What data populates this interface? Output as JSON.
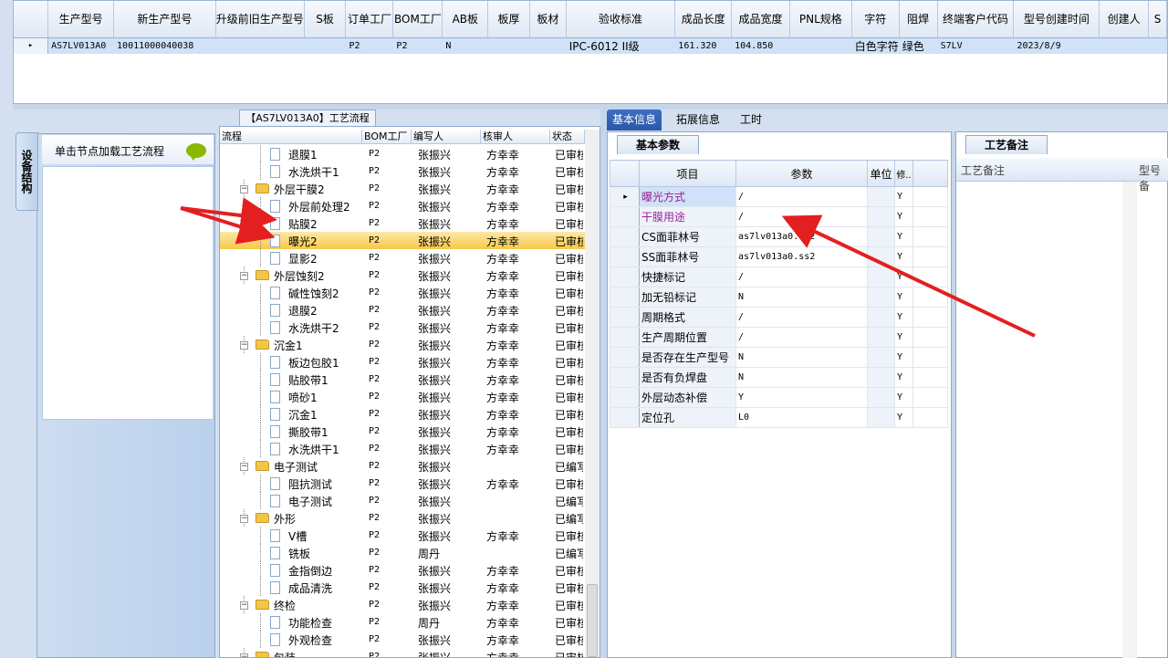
{
  "top_grid": {
    "columns": [
      "生产型号",
      "新生产型号",
      "升级前旧生产型号",
      "S板",
      "订单工厂",
      "BOM工厂",
      "AB板",
      "板厚",
      "板材",
      "验收标准",
      "成品长度",
      "成品宽度",
      "PNL规格",
      "字符",
      "阻焊",
      "终端客户代码",
      "型号创建时间",
      "创建人",
      "S"
    ],
    "row": [
      "AS7LV013A0",
      "10011000040038",
      "",
      "",
      "P2",
      "P2",
      "N",
      "",
      "",
      "IPC-6012 II级",
      "161.320",
      "104.850",
      "",
      "白色字符",
      "绿色",
      "S7LV",
      "2023/8/9",
      "",
      ""
    ],
    "row_indicator": "▸"
  },
  "side": {
    "vertical_tab": "设备结构",
    "header": "单击节点加载工艺流程"
  },
  "tree": {
    "title": "【AS7LV013A0】工艺流程",
    "columns": [
      "流程",
      "BOM工厂",
      "编写人",
      "核审人",
      "状态"
    ],
    "rows": [
      {
        "label": "退膜1",
        "level": 2,
        "type": "file",
        "bom": "P2",
        "writer": "张振兴",
        "reviewer": "方幸幸",
        "status": "已审核"
      },
      {
        "label": "水洗烘干1",
        "level": 2,
        "type": "file",
        "bom": "P2",
        "writer": "张振兴",
        "reviewer": "方幸幸",
        "status": "已审核"
      },
      {
        "label": "外层干膜2",
        "level": 1,
        "type": "folder",
        "bom": "P2",
        "writer": "张振兴",
        "reviewer": "方幸幸",
        "status": "已审核"
      },
      {
        "label": "外层前处理2",
        "level": 2,
        "type": "file",
        "bom": "P2",
        "writer": "张振兴",
        "reviewer": "方幸幸",
        "status": "已审核"
      },
      {
        "label": "贴膜2",
        "level": 2,
        "type": "file",
        "bom": "P2",
        "writer": "张振兴",
        "reviewer": "方幸幸",
        "status": "已审核"
      },
      {
        "label": "曝光2",
        "level": 2,
        "type": "file",
        "bom": "P2",
        "writer": "张振兴",
        "reviewer": "方幸幸",
        "status": "已审核",
        "selected": true
      },
      {
        "label": "显影2",
        "level": 2,
        "type": "file",
        "bom": "P2",
        "writer": "张振兴",
        "reviewer": "方幸幸",
        "status": "已审核"
      },
      {
        "label": "外层蚀刻2",
        "level": 1,
        "type": "folder",
        "bom": "P2",
        "writer": "张振兴",
        "reviewer": "方幸幸",
        "status": "已审核"
      },
      {
        "label": "碱性蚀刻2",
        "level": 2,
        "type": "file",
        "bom": "P2",
        "writer": "张振兴",
        "reviewer": "方幸幸",
        "status": "已审核"
      },
      {
        "label": "退膜2",
        "level": 2,
        "type": "file",
        "bom": "P2",
        "writer": "张振兴",
        "reviewer": "方幸幸",
        "status": "已审核"
      },
      {
        "label": "水洗烘干2",
        "level": 2,
        "type": "file",
        "bom": "P2",
        "writer": "张振兴",
        "reviewer": "方幸幸",
        "status": "已审核"
      },
      {
        "label": "沉金1",
        "level": 1,
        "type": "folder",
        "bom": "P2",
        "writer": "张振兴",
        "reviewer": "方幸幸",
        "status": "已审核"
      },
      {
        "label": "板边包胶1",
        "level": 2,
        "type": "file",
        "bom": "P2",
        "writer": "张振兴",
        "reviewer": "方幸幸",
        "status": "已审核"
      },
      {
        "label": "贴胶带1",
        "level": 2,
        "type": "file",
        "bom": "P2",
        "writer": "张振兴",
        "reviewer": "方幸幸",
        "status": "已审核"
      },
      {
        "label": "喷砂1",
        "level": 2,
        "type": "file",
        "bom": "P2",
        "writer": "张振兴",
        "reviewer": "方幸幸",
        "status": "已审核"
      },
      {
        "label": "沉金1",
        "level": 2,
        "type": "file",
        "bom": "P2",
        "writer": "张振兴",
        "reviewer": "方幸幸",
        "status": "已审核"
      },
      {
        "label": "撕胶带1",
        "level": 2,
        "type": "file",
        "bom": "P2",
        "writer": "张振兴",
        "reviewer": "方幸幸",
        "status": "已审核"
      },
      {
        "label": "水洗烘干1",
        "level": 2,
        "type": "file",
        "bom": "P2",
        "writer": "张振兴",
        "reviewer": "方幸幸",
        "status": "已审核"
      },
      {
        "label": "电子测试",
        "level": 1,
        "type": "folder",
        "bom": "P2",
        "writer": "张振兴",
        "reviewer": "",
        "status": "已编写"
      },
      {
        "label": "阻抗测试",
        "level": 2,
        "type": "file",
        "bom": "P2",
        "writer": "张振兴",
        "reviewer": "方幸幸",
        "status": "已审核"
      },
      {
        "label": "电子测试",
        "level": 2,
        "type": "file",
        "bom": "P2",
        "writer": "张振兴",
        "reviewer": "",
        "status": "已编写"
      },
      {
        "label": "外形",
        "level": 1,
        "type": "folder",
        "bom": "P2",
        "writer": "张振兴",
        "reviewer": "",
        "status": "已编写"
      },
      {
        "label": "V槽",
        "level": 2,
        "type": "file",
        "bom": "P2",
        "writer": "张振兴",
        "reviewer": "方幸幸",
        "status": "已审核"
      },
      {
        "label": "铣板",
        "level": 2,
        "type": "file",
        "bom": "P2",
        "writer": "周丹",
        "reviewer": "",
        "status": "已编写"
      },
      {
        "label": "金指倒边",
        "level": 2,
        "type": "file",
        "bom": "P2",
        "writer": "张振兴",
        "reviewer": "方幸幸",
        "status": "已审核"
      },
      {
        "label": "成品清洗",
        "level": 2,
        "type": "file",
        "bom": "P2",
        "writer": "张振兴",
        "reviewer": "方幸幸",
        "status": "已审核"
      },
      {
        "label": "终检",
        "level": 1,
        "type": "folder",
        "bom": "P2",
        "writer": "张振兴",
        "reviewer": "方幸幸",
        "status": "已审核"
      },
      {
        "label": "功能检查",
        "level": 2,
        "type": "file",
        "bom": "P2",
        "writer": "周丹",
        "reviewer": "方幸幸",
        "status": "已审核"
      },
      {
        "label": "外观检查",
        "level": 2,
        "type": "file",
        "bom": "P2",
        "writer": "张振兴",
        "reviewer": "方幸幸",
        "status": "已审核"
      },
      {
        "label": "包装",
        "level": 1,
        "type": "folder",
        "bom": "P2",
        "writer": "张振兴",
        "reviewer": "方幸幸",
        "status": "已审核"
      }
    ]
  },
  "right_tabs": [
    "基本信息",
    "拓展信息",
    "工时"
  ],
  "basic": {
    "subtab": "基本参数",
    "columns": [
      "项目",
      "参数",
      "单位",
      "修.."
    ],
    "rows": [
      {
        "item": "曝光方式",
        "value": "/",
        "unit": "",
        "mod": "Y",
        "highlight": true
      },
      {
        "item": "干膜用途",
        "value": "/",
        "unit": "",
        "mod": "Y",
        "highlight": true
      },
      {
        "item": "CS面菲林号",
        "value": "as7lv013a0.cs2",
        "unit": "",
        "mod": "Y"
      },
      {
        "item": "SS面菲林号",
        "value": "as7lv013a0.ss2",
        "unit": "",
        "mod": "Y"
      },
      {
        "item": "快捷标记",
        "value": "/",
        "unit": "",
        "mod": "Y"
      },
      {
        "item": "加无铅标记",
        "value": "N",
        "unit": "",
        "mod": "Y"
      },
      {
        "item": "周期格式",
        "value": "/",
        "unit": "",
        "mod": "Y"
      },
      {
        "item": "生产周期位置",
        "value": "/",
        "unit": "",
        "mod": "Y"
      },
      {
        "item": "是否存在生产型号",
        "value": "N",
        "unit": "",
        "mod": "Y"
      },
      {
        "item": "是否有负焊盘",
        "value": "N",
        "unit": "",
        "mod": "Y"
      },
      {
        "item": "外层动态补偿",
        "value": "Y",
        "unit": "",
        "mod": "Y"
      },
      {
        "item": "定位孔",
        "value": "L0",
        "unit": "",
        "mod": "Y"
      }
    ]
  },
  "notes": {
    "subtab": "工艺备注",
    "columns": [
      "工艺备注",
      "型号备"
    ]
  },
  "colors": {
    "arrow": "#e41f1f",
    "selected_row": "#f7c948",
    "tab_active": "#2a57a8",
    "highlight_text": "#a0209a"
  }
}
